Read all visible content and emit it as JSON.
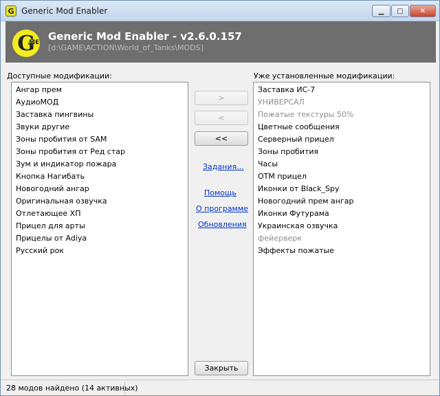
{
  "window": {
    "title": "Generic Mod Enabler",
    "icon_letter": "G",
    "controls": {
      "minimize": "▁",
      "maximize": "□",
      "close": "✕"
    }
  },
  "header": {
    "logo_letter": "G",
    "logo_sub": "ME",
    "title": "Generic Mod Enabler - v2.6.0.157",
    "path": "[d:\\GAME\\ACTION\\World_of_Tanks\\MODS]"
  },
  "available": {
    "label": "Доступные модификации:",
    "items": [
      "Ангар прем",
      "АудиоМОД",
      "Заставка пингвины",
      "Звуки другие",
      "Зоны пробития от SAM",
      "Зоны пробития от Ред стар",
      "Зум и индикатор пожара",
      "Кнопка Нагибать",
      "Новогодний ангар",
      "Оригинальная озвучка",
      "Отлетающее ХП",
      "Прицел для арты",
      "Прицелы от Adiya",
      "Русский рок"
    ]
  },
  "installed": {
    "label": "Уже установленные модификации:",
    "items": [
      {
        "name": "Заставка ИС-7",
        "active": true
      },
      {
        "name": "УНИВЕРСАЛ",
        "active": false
      },
      {
        "name": "Пожатые текстуры 50%",
        "active": false
      },
      {
        "name": "Цветные сообщения",
        "active": true
      },
      {
        "name": "Серверный прицел",
        "active": true
      },
      {
        "name": "Зоны пробития",
        "active": true
      },
      {
        "name": "Часы",
        "active": true
      },
      {
        "name": "ОТМ прицел",
        "active": true
      },
      {
        "name": "Иконки от Black_Spy",
        "active": true
      },
      {
        "name": "Новогодний прем ангар",
        "active": true
      },
      {
        "name": "Иконки Футурама",
        "active": true
      },
      {
        "name": "Украинская озвучка",
        "active": true
      },
      {
        "name": "фейерверк",
        "active": false
      },
      {
        "name": "Эффекты пожатые",
        "active": true
      }
    ]
  },
  "buttons": {
    "activate": ">",
    "deactivate": "<",
    "deactivate_all": "<<",
    "close": "Закрыть"
  },
  "links": {
    "tasks": "Задания...",
    "help": "Помощь",
    "about": "О программе",
    "updates": "Обновления"
  },
  "status": {
    "text": "28 модов найдено (14 активных)"
  }
}
